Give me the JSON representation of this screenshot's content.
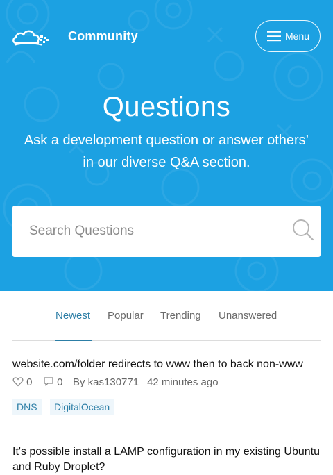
{
  "header": {
    "brand": "Community",
    "menu_label": "Menu"
  },
  "hero": {
    "title": "Questions",
    "subtitle": "Ask a development question or answer others’ in our diverse Q&A section."
  },
  "search": {
    "placeholder": "Search Questions"
  },
  "tabs": [
    {
      "label": "Newest",
      "active": true
    },
    {
      "label": "Popular",
      "active": false
    },
    {
      "label": "Trending",
      "active": false
    },
    {
      "label": "Unanswered",
      "active": false
    }
  ],
  "questions": [
    {
      "title": "website.com/folder redirects to www then to back non-www",
      "likes": "0",
      "comments": "0",
      "author": "By kas130771",
      "time": "42 minutes ago",
      "tags": [
        "DNS",
        "DigitalOcean"
      ]
    },
    {
      "title": "It's possible install a LAMP configuration in my existing Ubuntu and Ruby Droplet?"
    }
  ],
  "colors": {
    "hero_bg": "#1ca1e2",
    "accent": "#2c7ea6",
    "tag_bg": "#eef6fb"
  }
}
